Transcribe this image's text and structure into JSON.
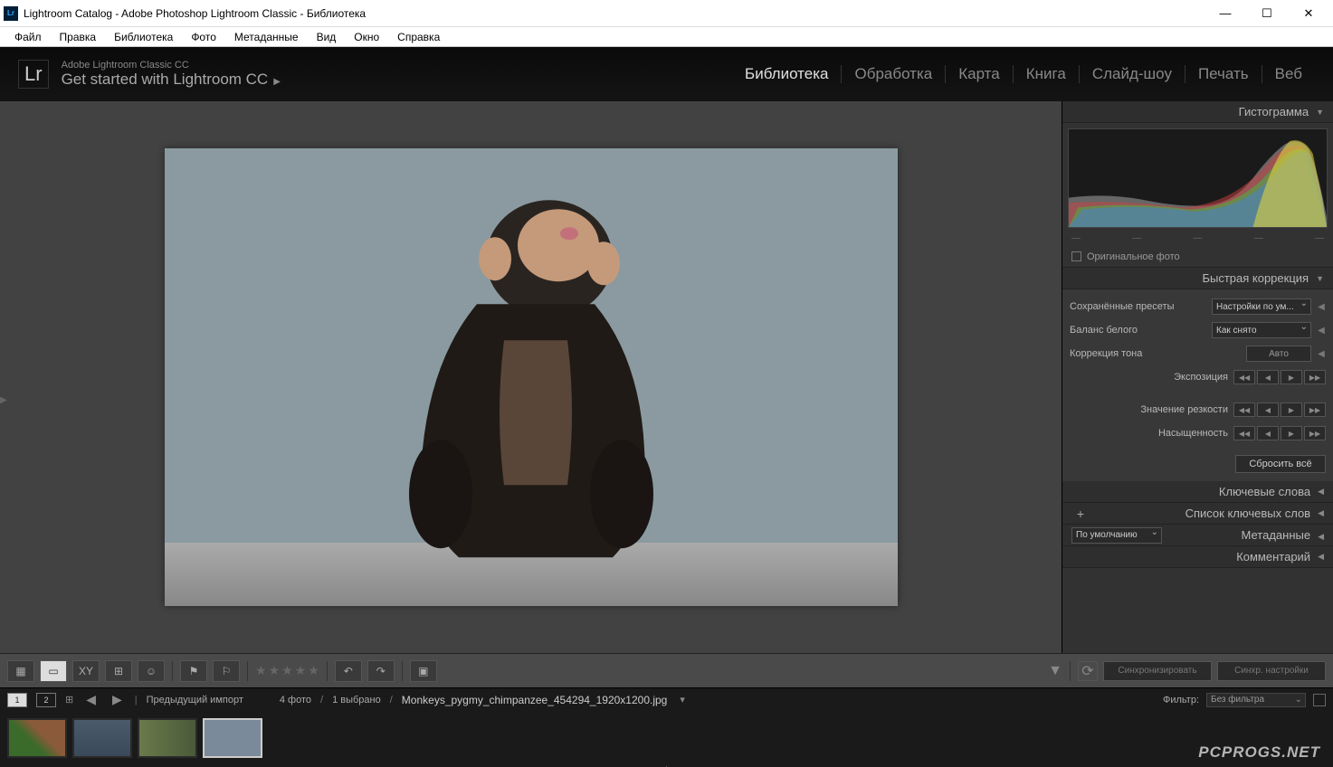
{
  "window": {
    "title": "Lightroom Catalog - Adobe Photoshop Lightroom Classic - Библиотека",
    "appicon_text": "Lr"
  },
  "menu": [
    "Файл",
    "Правка",
    "Библиотека",
    "Фото",
    "Метаданные",
    "Вид",
    "Окно",
    "Справка"
  ],
  "header": {
    "logo": "Lr",
    "product": "Adobe Lightroom Classic CC",
    "tagline": "Get started with Lightroom CC"
  },
  "modules": [
    "Библиотека",
    "Обработка",
    "Карта",
    "Книга",
    "Слайд-шоу",
    "Печать",
    "Веб"
  ],
  "active_module_index": 0,
  "panels": {
    "histogram": {
      "title": "Гистограмма",
      "orig_label": "Оригинальное фото"
    },
    "quickdev": {
      "title": "Быстрая коррекция",
      "saved_presets_label": "Сохранённые пресеты",
      "saved_presets_value": "Настройки по ум...",
      "wb_label": "Баланс белого",
      "wb_value": "Как снято",
      "tone_label": "Коррекция тона",
      "auto_label": "Авто",
      "exposure_label": "Экспозиция",
      "clarity_label": "Значение резкости",
      "saturation_label": "Насыщенность",
      "reset_label": "Сбросить всё"
    },
    "keywords": {
      "title": "Ключевые слова"
    },
    "keyword_list": {
      "title": "Список ключевых слов"
    },
    "metadata": {
      "title": "Метаданные",
      "preset": "По умолчанию"
    },
    "comments": {
      "title": "Комментарий"
    }
  },
  "toolbar": {
    "sync": "Синхронизировать",
    "sync_settings": "Синхр. настройки"
  },
  "filmstrip": {
    "source": "Предыдущий импорт",
    "count": "4 фото",
    "selected": "1 выбрано",
    "filename": "Monkeys_pygmy_chimpanzee_454294_1920x1200.jpg",
    "filter_label": "Фильтр:",
    "filter_value": "Без фильтра",
    "grid_icon": "⊞"
  },
  "watermark": "PCPROGS.NET"
}
